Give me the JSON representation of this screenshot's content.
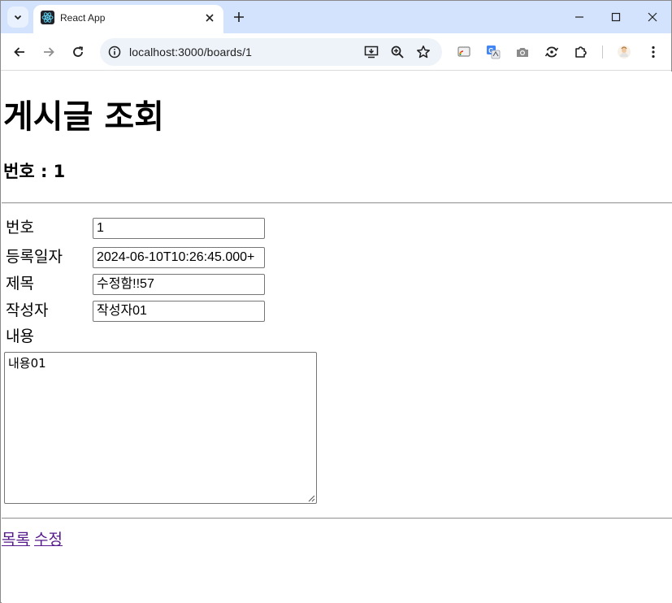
{
  "browser": {
    "tab_title": "React App",
    "url": "localhost:3000/boards/1",
    "icons": {
      "tab_search": "chevron-down-icon",
      "tab_close": "close-icon",
      "new_tab": "plus-icon",
      "minimize": "minimize-icon",
      "maximize": "maximize-icon",
      "close": "close-icon",
      "back": "arrow-left-icon",
      "forward": "arrow-right-icon",
      "reload": "reload-icon",
      "site_info": "info-icon",
      "install": "install-app-icon",
      "zoom": "zoom-icon",
      "bookmark": "star-icon",
      "extensions": "puzzle-icon",
      "menu": "kebab-menu-icon"
    },
    "accent_color": "#d3e3fd"
  },
  "page": {
    "title": "게시글 조회",
    "subtitle": "번호 : 1",
    "fields": [
      {
        "label": "번호",
        "value": "1"
      },
      {
        "label": "등록일자",
        "value": "2024-06-10T10:26:45.000+"
      },
      {
        "label": "제목",
        "value": "수정함!!57"
      },
      {
        "label": "작성자",
        "value": "작성자01"
      }
    ],
    "content_label": "내용",
    "content_value": "내용01",
    "links": {
      "list": "목록",
      "edit": "수정"
    },
    "link_color": "#551a8b"
  }
}
